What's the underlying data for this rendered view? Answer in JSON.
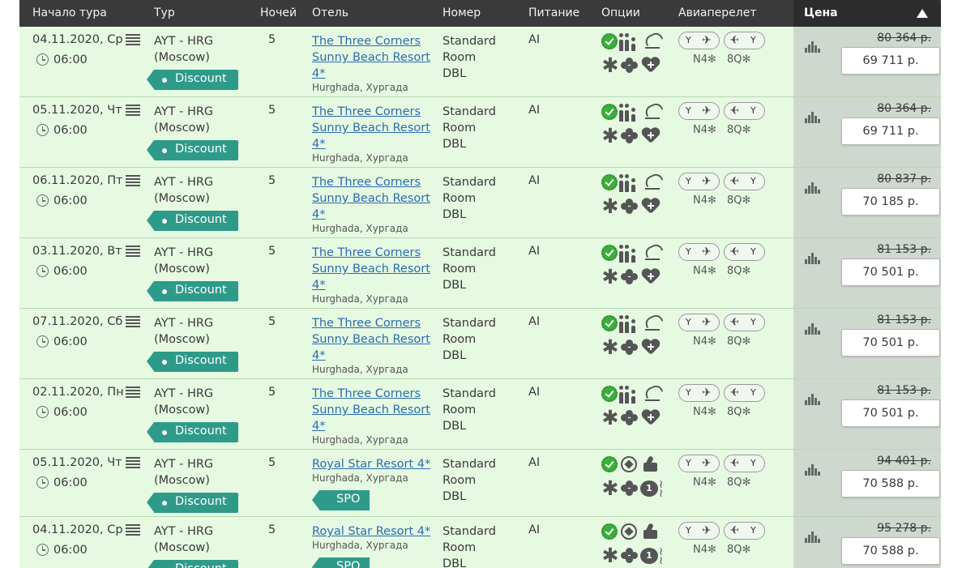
{
  "header": {
    "start": "Начало тура",
    "tour": "Тур",
    "nights": "Ночей",
    "hotel": "Отель",
    "room": "Номер",
    "meal": "Питание",
    "options": "Опции",
    "flight": "Авиаперелет",
    "price": "Цена"
  },
  "rows": [
    {
      "date": "04.11.2020, Ср",
      "time": "06:00",
      "route1": "AYT - HRG",
      "route2": "(Moscow)",
      "tag": "Discount",
      "nights": "5",
      "hotel1": "The Three Corners",
      "hotel2": "Sunny Beach Resort",
      "hotel3": "4*",
      "city": "Hurghada, Хургада",
      "room1": "Standard",
      "room2": "Room",
      "room3": "DBL",
      "meal": "AI",
      "cls_out": "Y",
      "cls_in": "Y",
      "code_out": "N4",
      "code_in": "8Q",
      "old": "80 364 р.",
      "price": "69 711 р."
    },
    {
      "date": "05.11.2020, Чт",
      "time": "06:00",
      "route1": "AYT - HRG",
      "route2": "(Moscow)",
      "tag": "Discount",
      "nights": "5",
      "hotel1": "The Three Corners",
      "hotel2": "Sunny Beach Resort",
      "hotel3": "4*",
      "city": "Hurghada, Хургада",
      "room1": "Standard",
      "room2": "Room",
      "room3": "DBL",
      "meal": "AI",
      "cls_out": "Y",
      "cls_in": "Y",
      "code_out": "N4",
      "code_in": "8Q",
      "old": "80 364 р.",
      "price": "69 711 р."
    },
    {
      "date": "06.11.2020, Пт",
      "time": "06:00",
      "route1": "AYT - HRG",
      "route2": "(Moscow)",
      "tag": "Discount",
      "nights": "5",
      "hotel1": "The Three Corners",
      "hotel2": "Sunny Beach Resort",
      "hotel3": "4*",
      "city": "Hurghada, Хургада",
      "room1": "Standard",
      "room2": "Room",
      "room3": "DBL",
      "meal": "AI",
      "cls_out": "Y",
      "cls_in": "Y",
      "code_out": "N4",
      "code_in": "8Q",
      "old": "80 837 р.",
      "price": "70 185 р."
    },
    {
      "date": "03.11.2020, Вт",
      "time": "06:00",
      "route1": "AYT - HRG",
      "route2": "(Moscow)",
      "tag": "Discount",
      "nights": "5",
      "hotel1": "The Three Corners",
      "hotel2": "Sunny Beach Resort",
      "hotel3": "4*",
      "city": "Hurghada, Хургада",
      "room1": "Standard",
      "room2": "Room",
      "room3": "DBL",
      "meal": "AI",
      "cls_out": "Y",
      "cls_in": "Y",
      "code_out": "N4",
      "code_in": "8Q",
      "old": "81 153 р.",
      "price": "70 501 р."
    },
    {
      "date": "07.11.2020, Сб",
      "time": "06:00",
      "route1": "AYT - HRG",
      "route2": "(Moscow)",
      "tag": "Discount",
      "nights": "5",
      "hotel1": "The Three Corners",
      "hotel2": "Sunny Beach Resort",
      "hotel3": "4*",
      "city": "Hurghada, Хургада",
      "room1": "Standard",
      "room2": "Room",
      "room3": "DBL",
      "meal": "AI",
      "cls_out": "Y",
      "cls_in": "Y",
      "code_out": "N4",
      "code_in": "8Q",
      "old": "81 153 р.",
      "price": "70 501 р."
    },
    {
      "date": "02.11.2020, Пн",
      "time": "06:00",
      "route1": "AYT - HRG",
      "route2": "(Moscow)",
      "tag": "Discount",
      "nights": "5",
      "hotel1": "The Three Corners",
      "hotel2": "Sunny Beach Resort",
      "hotel3": "4*",
      "city": "Hurghada, Хургада",
      "room1": "Standard",
      "room2": "Room",
      "room3": "DBL",
      "meal": "AI",
      "cls_out": "Y",
      "cls_in": "Y",
      "code_out": "N4",
      "code_in": "8Q",
      "old": "81 153 р.",
      "price": "70 501 р."
    },
    {
      "date": "05.11.2020, Чт",
      "time": "06:00",
      "route1": "AYT - HRG",
      "route2": "(Moscow)",
      "tag": "Discount",
      "spo": "SPO",
      "nights": "5",
      "hotel1": "Royal Star Resort 4*",
      "city": "Hurghada, Хургада",
      "room1": "Standard",
      "room2": "Room",
      "room3": "DBL",
      "meal": "AI",
      "cls_out": "Y",
      "cls_in": "Y",
      "code_out": "N4",
      "code_in": "8Q",
      "old": "94 401 р.",
      "price": "70 588 р."
    },
    {
      "date": "04.11.2020, Ср",
      "time": "06:00",
      "route1": "AYT - HRG",
      "route2": "(Moscow)",
      "tag": "Discount",
      "spo": "SPO",
      "nights": "5",
      "hotel1": "Royal Star Resort 4*",
      "city": "Hurghada, Хургада",
      "room1": "Standard",
      "room2": "Room",
      "room3": "DBL",
      "meal": "AI",
      "cls_out": "Y",
      "cls_in": "Y",
      "code_out": "N4",
      "code_in": "8Q",
      "old": "95 278 р.",
      "price": "70 588 р."
    }
  ],
  "option_icons_a": [
    "check-badge-icon",
    "family-icon",
    "beach-umbrella-icon",
    "flower-icon",
    "cluster-icon",
    "heart-plus-icon"
  ],
  "option_icons_b": [
    "check-badge-icon",
    "football-icon",
    "thumbs-up-icon",
    "flower-icon",
    "cluster-icon",
    "one-badge-icon",
    "waves-icon"
  ],
  "colors": {
    "header_bg": "#3a3a3a",
    "row_bg": "#e6fae2",
    "price_col": "#cfd8cf",
    "tag": "#2e9a8a",
    "link": "#2b6cb0",
    "check": "#3cae3c"
  }
}
